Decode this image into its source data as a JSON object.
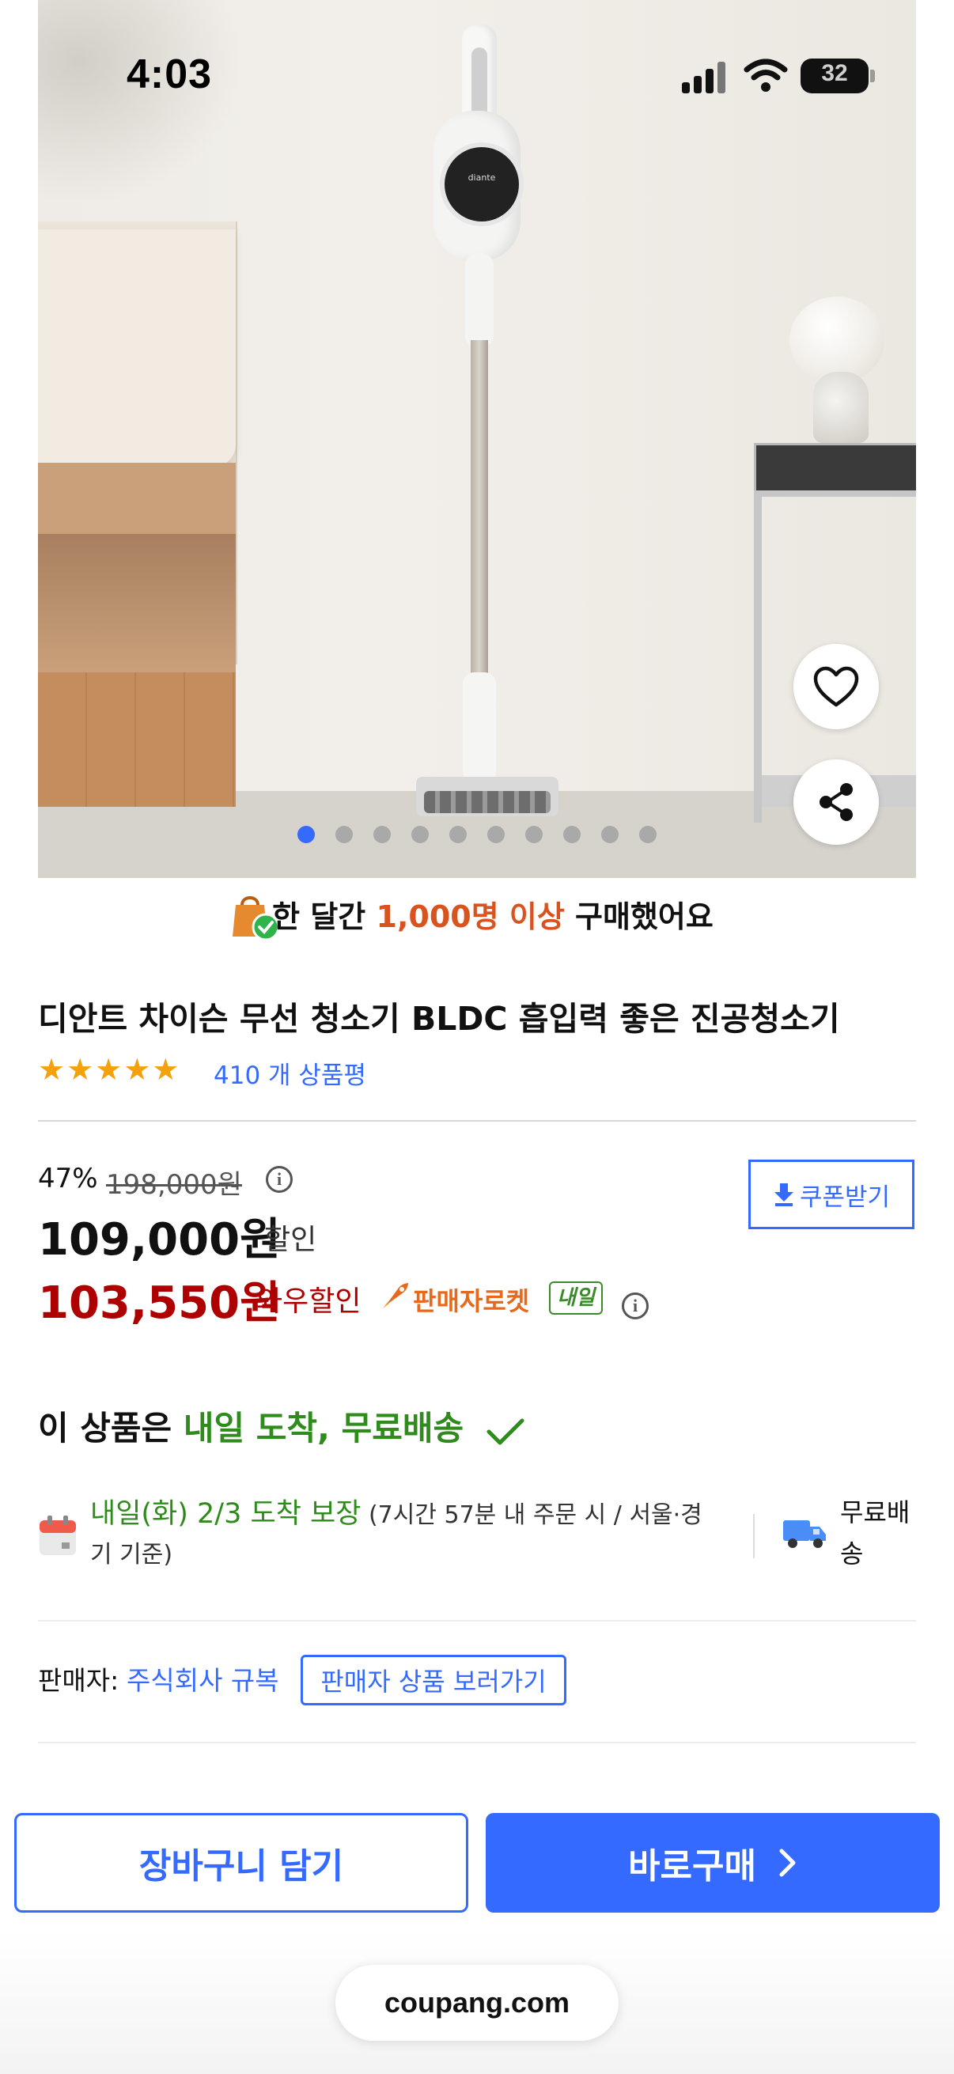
{
  "status_bar": {
    "time": "4:03",
    "battery": "32"
  },
  "hero": {
    "brand_mark": "diante",
    "dots_total": 10,
    "active_dot": 0
  },
  "social_proof": {
    "prefix": "한 달간 ",
    "highlight": "1,000명 이상",
    "suffix": " 구매했어요"
  },
  "product": {
    "title": "디안트 차이슨 무선 청소기 BLDC 흡입력 좋은 진공청소기",
    "rating_stars": 5,
    "review_count": "410 개 상품평"
  },
  "pricing": {
    "discount_rate": "47%",
    "original_price": "198,000원",
    "sale_price": "109,000원",
    "sale_label": "할인",
    "wow_price": "103,550원",
    "wow_label": "와우할인",
    "rocket_label": "판매자로켓",
    "tomorrow_badge": "내일",
    "coupon_label": "쿠폰받기"
  },
  "delivery": {
    "headline_prefix": "이 상품은 ",
    "headline_highlight": "내일 도착, 무료배송",
    "arrival": "내일(화) 2/3 도착 보장",
    "arrival_note": " (7시간 57분 내 주문 시 / 서울·경기 기준)",
    "shipping_fee": "무료배송"
  },
  "seller": {
    "label": "판매자: ",
    "name": "주식회사 규복",
    "link_label": "판매자 상품 보러가기"
  },
  "actions": {
    "cart": "장바구니 담기",
    "buy": "바로구매"
  },
  "browser": {
    "url": "coupang.com"
  },
  "colors": {
    "accent": "#346aff",
    "green": "#2e8b1c",
    "wow_red": "#ae0000",
    "orange": "#d9531e"
  }
}
